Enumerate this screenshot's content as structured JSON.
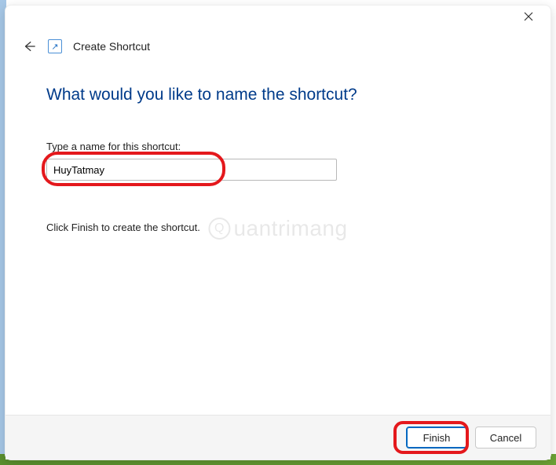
{
  "header": {
    "title": "Create Shortcut"
  },
  "main": {
    "heading": "What would you like to name the shortcut?",
    "input_label": "Type a name for this shortcut:",
    "input_value": "HuyTatmay",
    "instruction": "Click Finish to create the shortcut."
  },
  "footer": {
    "finish": "Finish",
    "cancel": "Cancel"
  },
  "watermark": "uantrimang"
}
